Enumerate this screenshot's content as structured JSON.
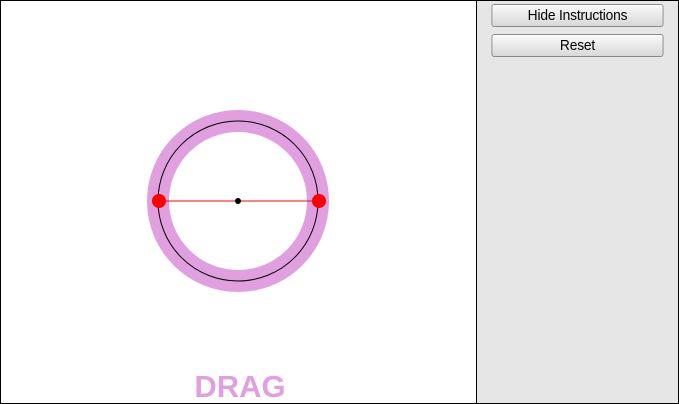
{
  "panel": {
    "hide_instructions_label": "Hide Instructions",
    "reset_label": "Reset"
  },
  "canvas": {
    "drag_hint": "DRAG"
  },
  "colors": {
    "ring": "#e0a0e0",
    "circle_stroke": "#000000",
    "diameter_line": "#ff0000",
    "handle": "#ff0000",
    "center_dot": "#000000",
    "drag_text": "#e0a0e0",
    "panel_bg": "#e6e6e6"
  }
}
